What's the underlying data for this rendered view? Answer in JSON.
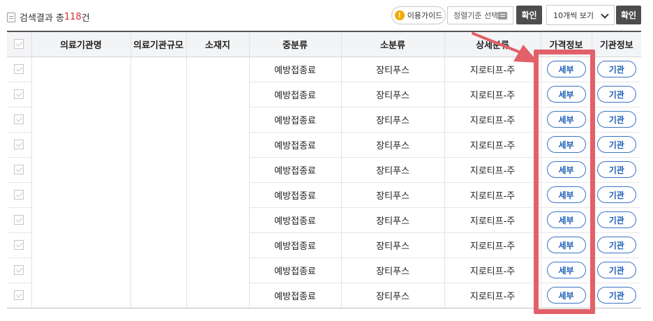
{
  "header": {
    "result_prefix": "검색결과 총 ",
    "result_count": "118",
    "result_suffix": "건",
    "guide_label": "이용가이드",
    "sort_label": "정렬기준 선택",
    "confirm_label": "확인",
    "per_page_label": "10개씩 보기",
    "confirm2_label": "확인"
  },
  "table": {
    "columns": [
      "의료기관명",
      "의료기관규모",
      "소재지",
      "중분류",
      "소분류",
      "상세분류",
      "가격정보",
      "기관정보"
    ],
    "rows": [
      {
        "mid": "예방접종료",
        "sub": "장티푸스",
        "detail": "지로티프-주",
        "price": "세부",
        "org": "기관"
      },
      {
        "mid": "예방접종료",
        "sub": "장티푸스",
        "detail": "지로티프-주",
        "price": "세부",
        "org": "기관"
      },
      {
        "mid": "예방접종료",
        "sub": "장티푸스",
        "detail": "지로티프-주",
        "price": "세부",
        "org": "기관"
      },
      {
        "mid": "예방접종료",
        "sub": "장티푸스",
        "detail": "지로티프-주",
        "price": "세부",
        "org": "기관"
      },
      {
        "mid": "예방접종료",
        "sub": "장티푸스",
        "detail": "지로티프-주",
        "price": "세부",
        "org": "기관"
      },
      {
        "mid": "예방접종료",
        "sub": "장티푸스",
        "detail": "지로티프-주",
        "price": "세부",
        "org": "기관"
      },
      {
        "mid": "예방접종료",
        "sub": "장티푸스",
        "detail": "지로티프-주",
        "price": "세부",
        "org": "기관"
      },
      {
        "mid": "예방접종료",
        "sub": "장티푸스",
        "detail": "지로티프-주",
        "price": "세부",
        "org": "기관"
      },
      {
        "mid": "예방접종료",
        "sub": "장티푸스",
        "detail": "지로티프-주",
        "price": "세부",
        "org": "기관"
      },
      {
        "mid": "예방접종료",
        "sub": "장티푸스",
        "detail": "지로티프-주",
        "price": "세부",
        "org": "기관"
      }
    ]
  },
  "annotation": {
    "color": "#e26068",
    "target": "price-column"
  },
  "colors": {
    "accent_count": "#d32f2f",
    "pill_border": "#3a73c4",
    "dark_button": "#4d4d4d"
  }
}
